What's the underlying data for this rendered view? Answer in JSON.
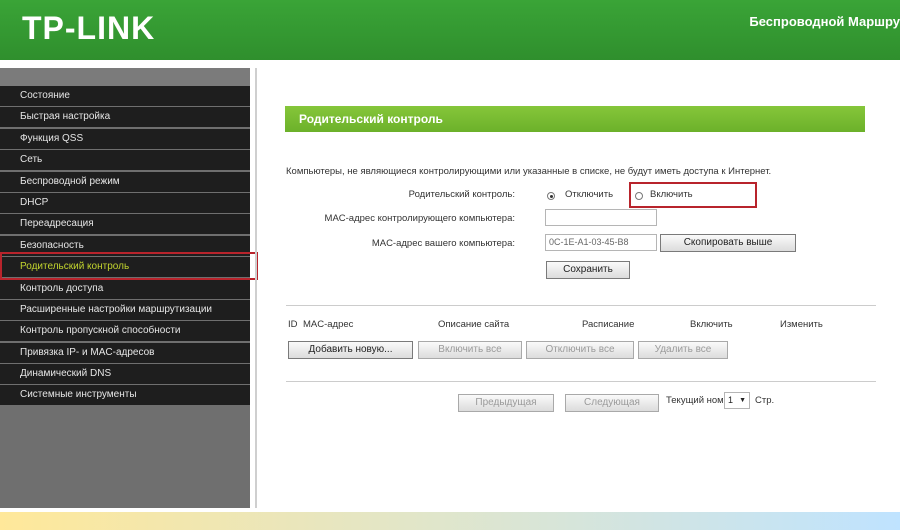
{
  "header": {
    "logo": "TP-LINK",
    "title": "Беспроводной Маршру"
  },
  "sidebar": {
    "items": [
      {
        "label": "Состояние"
      },
      {
        "label": "Быстрая настройка"
      },
      {
        "label": "Функция QSS"
      },
      {
        "label": "Сеть"
      },
      {
        "label": "Беспроводной режим"
      },
      {
        "label": "DHCP"
      },
      {
        "label": "Переадресация"
      },
      {
        "label": "Безопасность"
      },
      {
        "label": "Родительский контроль"
      },
      {
        "label": "Контроль доступа"
      },
      {
        "label": "Расширенные настройки маршрутизации"
      },
      {
        "label": "Контроль пропускной способности"
      },
      {
        "label": "Привязка IP- и MAC-адресов"
      },
      {
        "label": "Динамический DNS"
      },
      {
        "label": "Системные инструменты"
      }
    ]
  },
  "main": {
    "section_title": "Родительский контроль",
    "description": "Компьютеры, не являющиеся контролирующими или указанные в списке, не будут иметь доступа к Интернет.",
    "parental_control_label": "Родительский контроль:",
    "radio_off": "Отключить",
    "radio_on": "Включить",
    "mac_parent_label": "MAC-адрес контролирующего компьютера:",
    "mac_parent_value": "",
    "mac_current_label": "MAC-адрес вашего компьютера:",
    "mac_current_value": "0C-1E-A1-03-45-B8",
    "copy_button": "Скопировать выше",
    "save_button": "Сохранить",
    "table_headers": {
      "id": "ID",
      "mac": "MAC-адрес",
      "site": "Описание сайта",
      "schedule": "Расписание",
      "enable": "Включить",
      "edit": "Изменить"
    },
    "add_button": "Добавить новую...",
    "enable_all": "Включить все",
    "disable_all": "Отключить все",
    "delete_all": "Удалить все",
    "prev_button": "Предыдущая",
    "next_button": "Следующая",
    "page_label": "Текущий номер",
    "page_value": "1",
    "page_suffix": "Стр."
  }
}
